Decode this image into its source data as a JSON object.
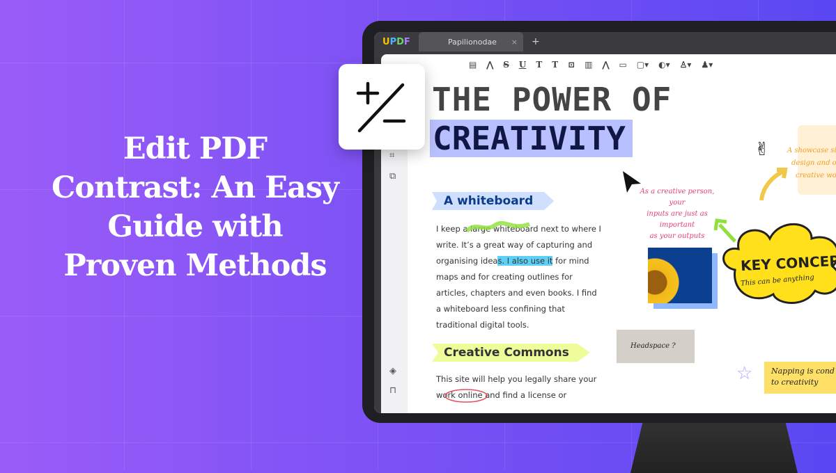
{
  "headline": {
    "lines": [
      "Edit PDF",
      "Contrast: An Easy",
      "Guide with",
      "Proven Methods"
    ]
  },
  "app": {
    "logo": "UPDF",
    "tab": "Papilionodae",
    "tab_close": "×",
    "new_tab": "+",
    "toolbar_icons": [
      "comment-icon",
      "highlight-icon",
      "strikethrough-icon",
      "underline-icon",
      "squiggly-icon",
      "text-icon",
      "textbox-icon",
      "callout-icon",
      "pencil-icon",
      "eraser-icon",
      "shape-icon",
      "sticker-icon",
      "stamp-icon",
      "signature-icon"
    ],
    "toolbar_glyphs": [
      "▤",
      "⋀",
      "S",
      "U",
      "T",
      "T",
      "⊡",
      "▥",
      "⋀",
      "▭",
      "▢▾",
      "◐▾",
      "♙▾",
      "♟▾"
    ],
    "sidebar_icons": [
      "pages-icon",
      "crop-icon",
      "ocr-icon",
      "layers-icon",
      "bookmark-icon"
    ]
  },
  "document": {
    "title_line1": "THE POWER OF",
    "title_line2": "CREATIVITY",
    "section1": "A whiteboard",
    "para1": [
      "I keep a large whiteboard next to where I",
      "write. It’s a great way of capturing and",
      "organising idea",
      "s. I also use it",
      " for mind",
      "maps and for creating outlines for",
      "articles, chapters and even books. I find",
      "a whiteboard less confining that",
      "traditional digital tools."
    ],
    "section2": "Creative Commons",
    "para2": [
      "This site will help you legally share your",
      "work online and find a license or"
    ],
    "note_pink": [
      "As a creative person, your",
      "inputs are just as important",
      "as your outputs"
    ],
    "note_orange": [
      "A showcase sit",
      "design and ot",
      "creative wor"
    ],
    "key_concept": "KEY CONCEPT",
    "key_sub": "This can be anything",
    "headspace": "Headspace ?",
    "napping": [
      "Napping is cond",
      "to creativity"
    ]
  },
  "colors": {
    "bg_left": "#9a5cf8",
    "bg_right": "#5a48f2",
    "highlight_title": "#b9c0ff",
    "highlight_text": "#5fd0f5",
    "ribbon1": "#cfe0ff",
    "ribbon2": "#eefc9a",
    "key_yellow": "#ffe01a"
  },
  "floating_icon": "plus-minus-icon"
}
